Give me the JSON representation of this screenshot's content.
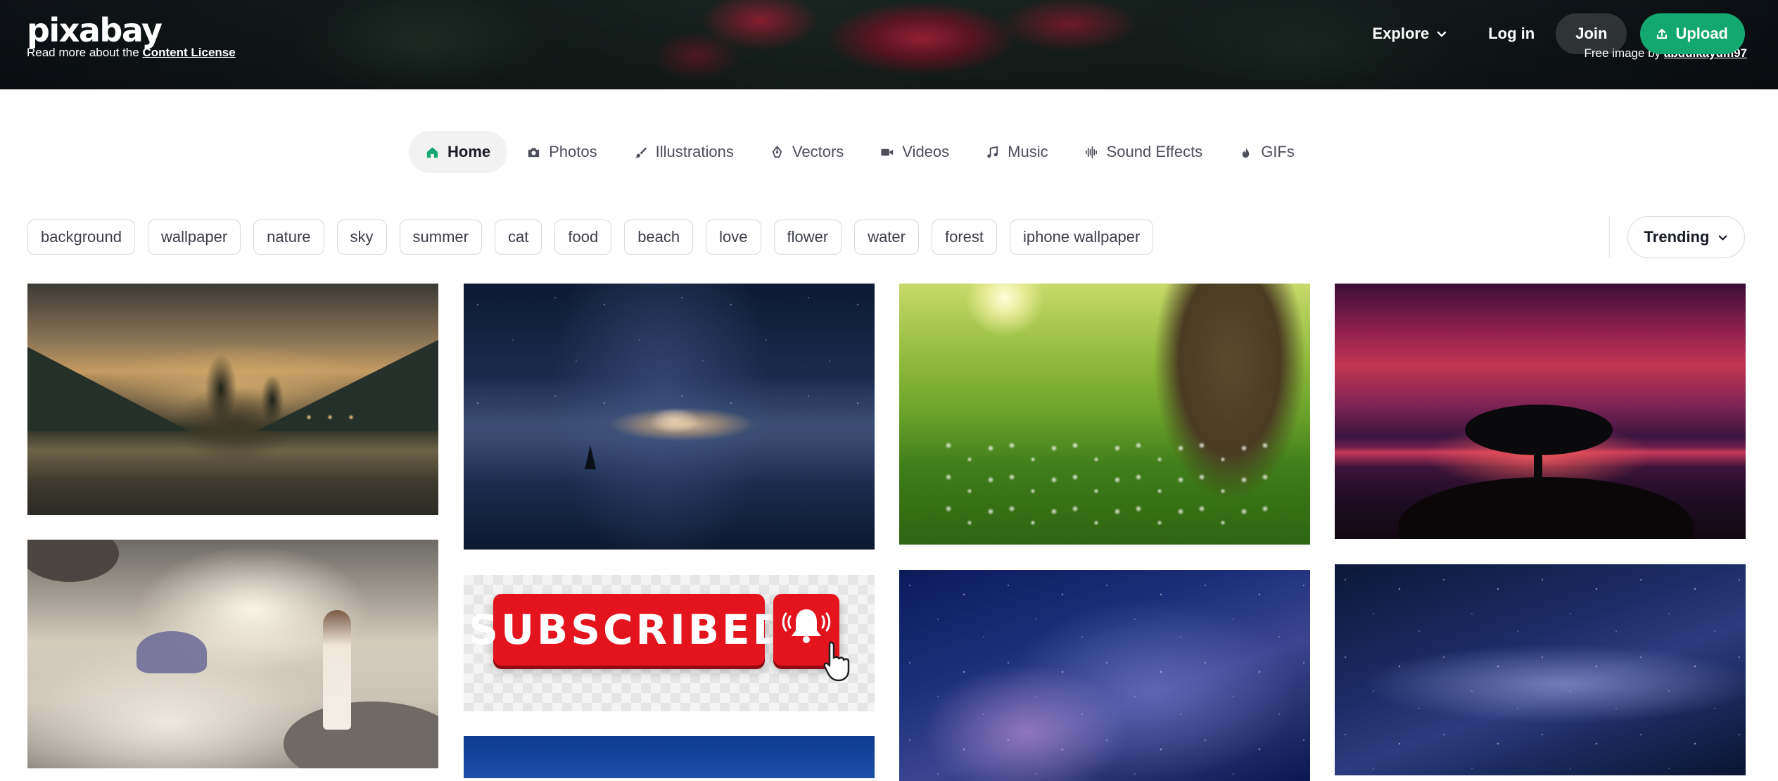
{
  "header": {
    "logo": "pixabay",
    "license_prefix": "Read more about the",
    "license_link": "Content License",
    "credit_prefix": "Free image by",
    "credit_author": "abdulkayum97",
    "nav": {
      "explore": "Explore",
      "login": "Log in",
      "join": "Join",
      "upload": "Upload"
    }
  },
  "tabs": [
    {
      "label": "Home",
      "icon": "home-icon",
      "active": true
    },
    {
      "label": "Photos",
      "icon": "camera-icon",
      "active": false
    },
    {
      "label": "Illustrations",
      "icon": "brush-icon",
      "active": false
    },
    {
      "label": "Vectors",
      "icon": "pen-nib-icon",
      "active": false
    },
    {
      "label": "Videos",
      "icon": "video-camera-icon",
      "active": false
    },
    {
      "label": "Music",
      "icon": "music-note-icon",
      "active": false
    },
    {
      "label": "Sound Effects",
      "icon": "waveform-icon",
      "active": false
    },
    {
      "label": "GIFs",
      "icon": "flame-icon",
      "active": false
    }
  ],
  "tags": [
    "background",
    "wallpaper",
    "nature",
    "sky",
    "summer",
    "cat",
    "food",
    "beach",
    "love",
    "flower",
    "water",
    "forest",
    "iphone wallpaper"
  ],
  "sort": {
    "selected": "Trending"
  },
  "gallery": {
    "subscribed_text": "SUBSCRIBED"
  },
  "colors": {
    "accent": "#13a86f",
    "text": "#191b26",
    "chip_border": "#d8d9de",
    "active_tab_bg": "#f2f2f3"
  }
}
